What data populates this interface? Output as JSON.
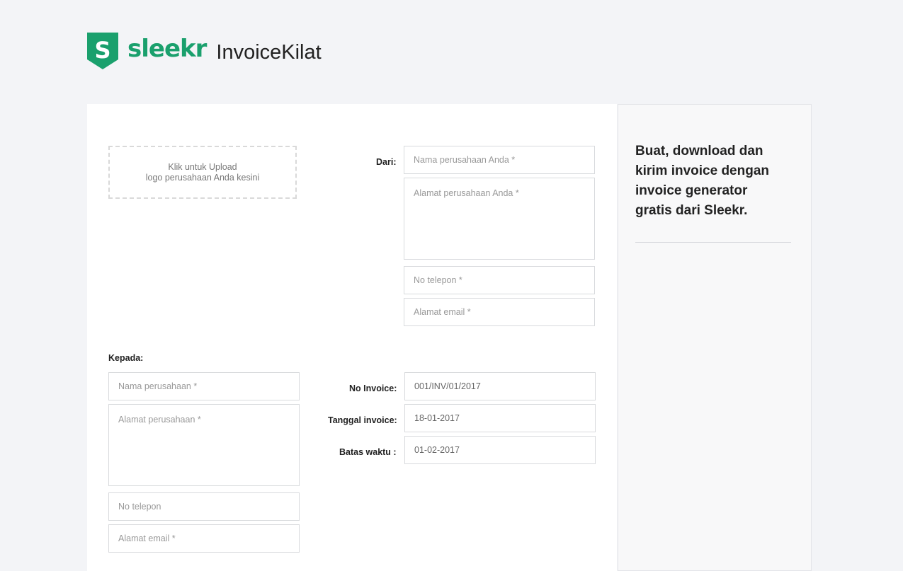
{
  "header": {
    "brand": "sleekr",
    "product": "InvoiceKilat",
    "logo_letter": "S",
    "brand_color": "#1aa06d"
  },
  "upload": {
    "line1": "Klik untuk Upload",
    "line2": "logo perusahaan Anda kesini"
  },
  "from": {
    "label": "Dari:",
    "company_name_placeholder": "Nama perusahaan Anda *",
    "company_address_placeholder": "Alamat perusahaan Anda *",
    "phone_placeholder": "No telepon *",
    "email_placeholder": "Alamat email *"
  },
  "to": {
    "label": "Kepada:",
    "company_name_placeholder": "Nama perusahaan *",
    "company_address_placeholder": "Alamat perusahaan *",
    "phone_placeholder": "No telepon",
    "email_placeholder": "Alamat email *"
  },
  "invoice": {
    "number_label": "No Invoice:",
    "number_value": "001/INV/01/2017",
    "date_label": "Tanggal invoice:",
    "date_value": "18-01-2017",
    "due_label": "Batas waktu :",
    "due_value": "01-02-2017"
  },
  "aside": {
    "text": "Buat, download dan kirim invoice dengan invoice generator gratis dari Sleekr."
  }
}
